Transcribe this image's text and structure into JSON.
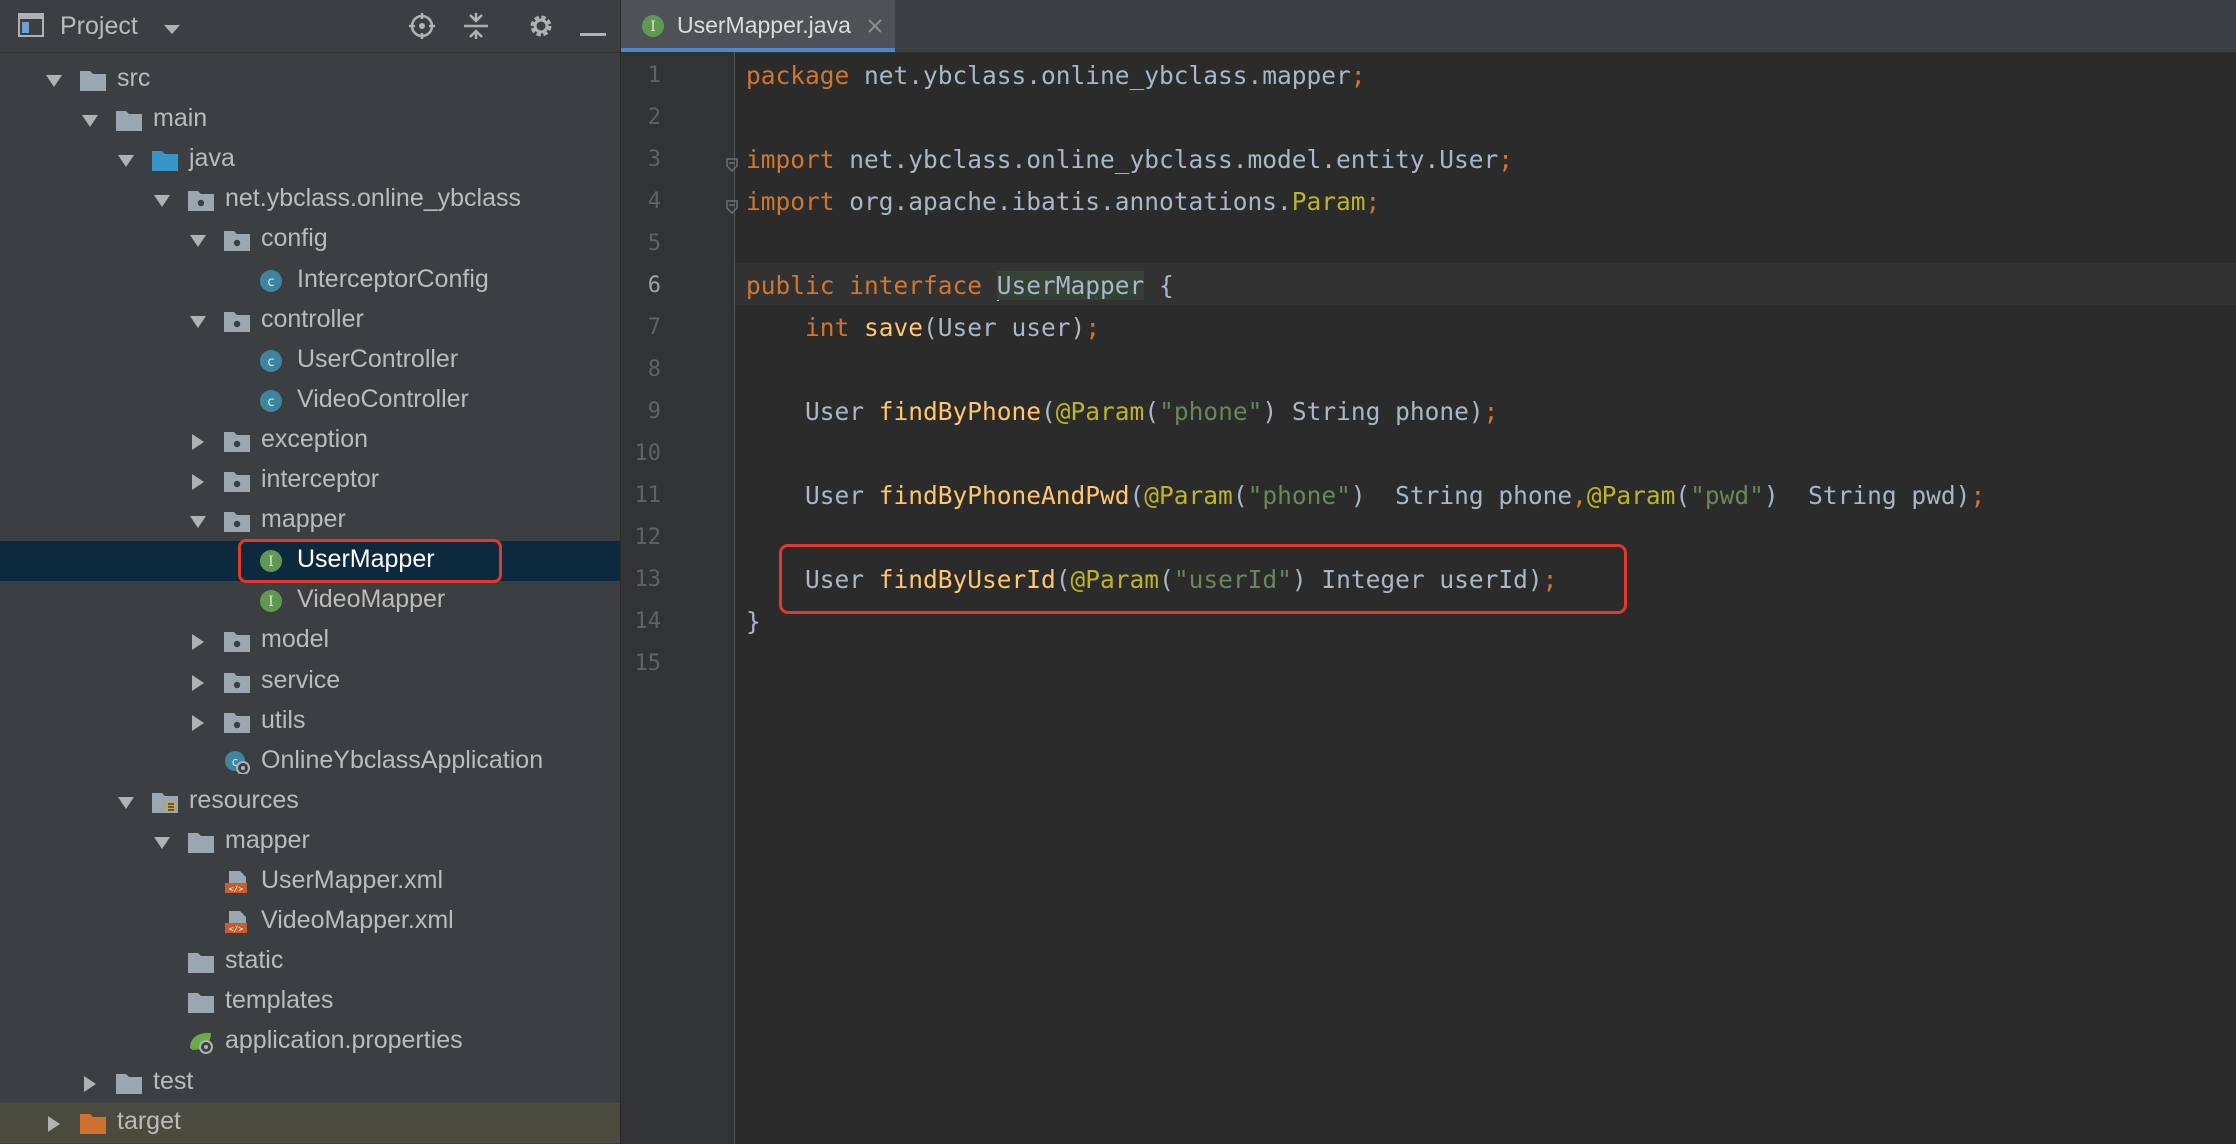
{
  "project_panel": {
    "title": "Project",
    "header_icons": [
      "project-view-icon",
      "dropdown-icon",
      "locate-icon",
      "collapse-all-icon",
      "settings-icon",
      "minimize-icon"
    ],
    "tree": [
      {
        "label": "src",
        "icon": "folder-icon",
        "arrow": "expanded",
        "depth": 0
      },
      {
        "label": "main",
        "icon": "folder-icon",
        "arrow": "expanded",
        "depth": 1
      },
      {
        "label": "java",
        "icon": "source-folder-icon",
        "arrow": "expanded",
        "depth": 2
      },
      {
        "label": "net.ybclass.online_ybclass",
        "icon": "package-icon",
        "arrow": "expanded",
        "depth": 3
      },
      {
        "label": "config",
        "icon": "package-icon",
        "arrow": "expanded",
        "depth": 4
      },
      {
        "label": "InterceptorConfig",
        "icon": "class-icon",
        "arrow": "none",
        "depth": 5
      },
      {
        "label": "controller",
        "icon": "package-icon",
        "arrow": "expanded",
        "depth": 4
      },
      {
        "label": "UserController",
        "icon": "class-icon",
        "arrow": "none",
        "depth": 5
      },
      {
        "label": "VideoController",
        "icon": "class-icon",
        "arrow": "none",
        "depth": 5
      },
      {
        "label": "exception",
        "icon": "package-icon",
        "arrow": "collapsed",
        "depth": 4
      },
      {
        "label": "interceptor",
        "icon": "package-icon",
        "arrow": "collapsed",
        "depth": 4
      },
      {
        "label": "mapper",
        "icon": "package-icon",
        "arrow": "expanded",
        "depth": 4
      },
      {
        "label": "UserMapper",
        "icon": "interface-icon",
        "arrow": "none",
        "depth": 5,
        "selected": true
      },
      {
        "label": "VideoMapper",
        "icon": "interface-icon",
        "arrow": "none",
        "depth": 5
      },
      {
        "label": "model",
        "icon": "package-icon",
        "arrow": "collapsed",
        "depth": 4
      },
      {
        "label": "service",
        "icon": "package-icon",
        "arrow": "collapsed",
        "depth": 4
      },
      {
        "label": "utils",
        "icon": "package-icon",
        "arrow": "collapsed",
        "depth": 4
      },
      {
        "label": "OnlineYbclassApplication",
        "icon": "spring-boot-class-icon",
        "arrow": "none",
        "depth": 4
      },
      {
        "label": "resources",
        "icon": "resources-folder-icon",
        "arrow": "expanded",
        "depth": 2
      },
      {
        "label": "mapper",
        "icon": "folder-icon",
        "arrow": "expanded",
        "depth": 3
      },
      {
        "label": "UserMapper.xml",
        "icon": "xml-file-icon",
        "arrow": "none",
        "depth": 4
      },
      {
        "label": "VideoMapper.xml",
        "icon": "xml-file-icon",
        "arrow": "none",
        "depth": 4
      },
      {
        "label": "static",
        "icon": "folder-icon",
        "arrow": "none",
        "depth": 3
      },
      {
        "label": "templates",
        "icon": "folder-icon",
        "arrow": "none",
        "depth": 3
      },
      {
        "label": "application.properties",
        "icon": "spring-properties-icon",
        "arrow": "none",
        "depth": 3
      },
      {
        "label": "test",
        "icon": "folder-icon",
        "arrow": "collapsed",
        "depth": 1
      },
      {
        "label": "target",
        "icon": "excluded-folder-icon",
        "arrow": "collapsed",
        "depth": 0,
        "excluded": true
      }
    ]
  },
  "editor": {
    "tab": {
      "label": "UserMapper.java",
      "icon": "interface-icon",
      "close_icon": "close-icon"
    },
    "current_line": 6,
    "lines": [
      {
        "n": "1",
        "tokens": [
          [
            "kw",
            "package "
          ],
          [
            "t",
            "net.ybclass.online_ybclass.mapper"
          ],
          [
            "sym",
            ";"
          ]
        ]
      },
      {
        "n": "2",
        "tokens": []
      },
      {
        "n": "3",
        "tokens": [
          [
            "kw",
            "import "
          ],
          [
            "t",
            "net.ybclass.online_ybclass.model.entity.User"
          ],
          [
            "sym",
            ";"
          ]
        ]
      },
      {
        "n": "4",
        "tokens": [
          [
            "kw",
            "import "
          ],
          [
            "t",
            "org.apache.ibatis.annotations."
          ],
          [
            "ann",
            "Param"
          ],
          [
            "sym",
            ";"
          ]
        ]
      },
      {
        "n": "5",
        "tokens": []
      },
      {
        "n": "6",
        "tokens": [
          [
            "kw",
            "public interface "
          ],
          [
            "caret",
            ""
          ],
          [
            "hl",
            "UserMapper"
          ],
          [
            "t",
            " {"
          ]
        ]
      },
      {
        "n": "7",
        "tokens": [
          [
            "t",
            "    "
          ],
          [
            "kw",
            "int "
          ],
          [
            "fn",
            "save"
          ],
          [
            "t",
            "(User user)"
          ],
          [
            "sym",
            ";"
          ]
        ]
      },
      {
        "n": "8",
        "tokens": []
      },
      {
        "n": "9",
        "tokens": [
          [
            "t",
            "    User "
          ],
          [
            "fn",
            "findByPhone"
          ],
          [
            "t",
            "("
          ],
          [
            "ann",
            "@Param"
          ],
          [
            "t",
            "("
          ],
          [
            "str",
            "\"phone\""
          ],
          [
            "t",
            ") String phone)"
          ],
          [
            "sym",
            ";"
          ]
        ]
      },
      {
        "n": "10",
        "tokens": []
      },
      {
        "n": "11",
        "tokens": [
          [
            "t",
            "    User "
          ],
          [
            "fn",
            "findByPhoneAndPwd"
          ],
          [
            "t",
            "("
          ],
          [
            "ann",
            "@Param"
          ],
          [
            "t",
            "("
          ],
          [
            "str",
            "\"phone\""
          ],
          [
            "t",
            ")  String phone"
          ],
          [
            "sym",
            ","
          ],
          [
            "ann",
            "@Param"
          ],
          [
            "t",
            "("
          ],
          [
            "str",
            "\"pwd\""
          ],
          [
            "t",
            ")  String pwd)"
          ],
          [
            "sym",
            ";"
          ]
        ]
      },
      {
        "n": "12",
        "tokens": []
      },
      {
        "n": "13",
        "tokens": [
          [
            "t",
            "    User "
          ],
          [
            "fn",
            "findByUserId"
          ],
          [
            "t",
            "("
          ],
          [
            "ann",
            "@Param"
          ],
          [
            "t",
            "("
          ],
          [
            "str",
            "\"userId\""
          ],
          [
            "t",
            ") Integer userId)"
          ],
          [
            "sym",
            ";"
          ]
        ]
      },
      {
        "n": "14",
        "tokens": [
          [
            "t",
            "}"
          ]
        ]
      },
      {
        "n": "15",
        "tokens": []
      }
    ]
  },
  "colors": {
    "panel_bg": "#3c3f41",
    "editor_bg": "#2b2b2b",
    "selection": "#0d293e",
    "highlight_box": "#e0392f",
    "keyword": "#cc7832",
    "method": "#ffc66d",
    "annotation": "#bbb529",
    "string": "#6a8759"
  }
}
